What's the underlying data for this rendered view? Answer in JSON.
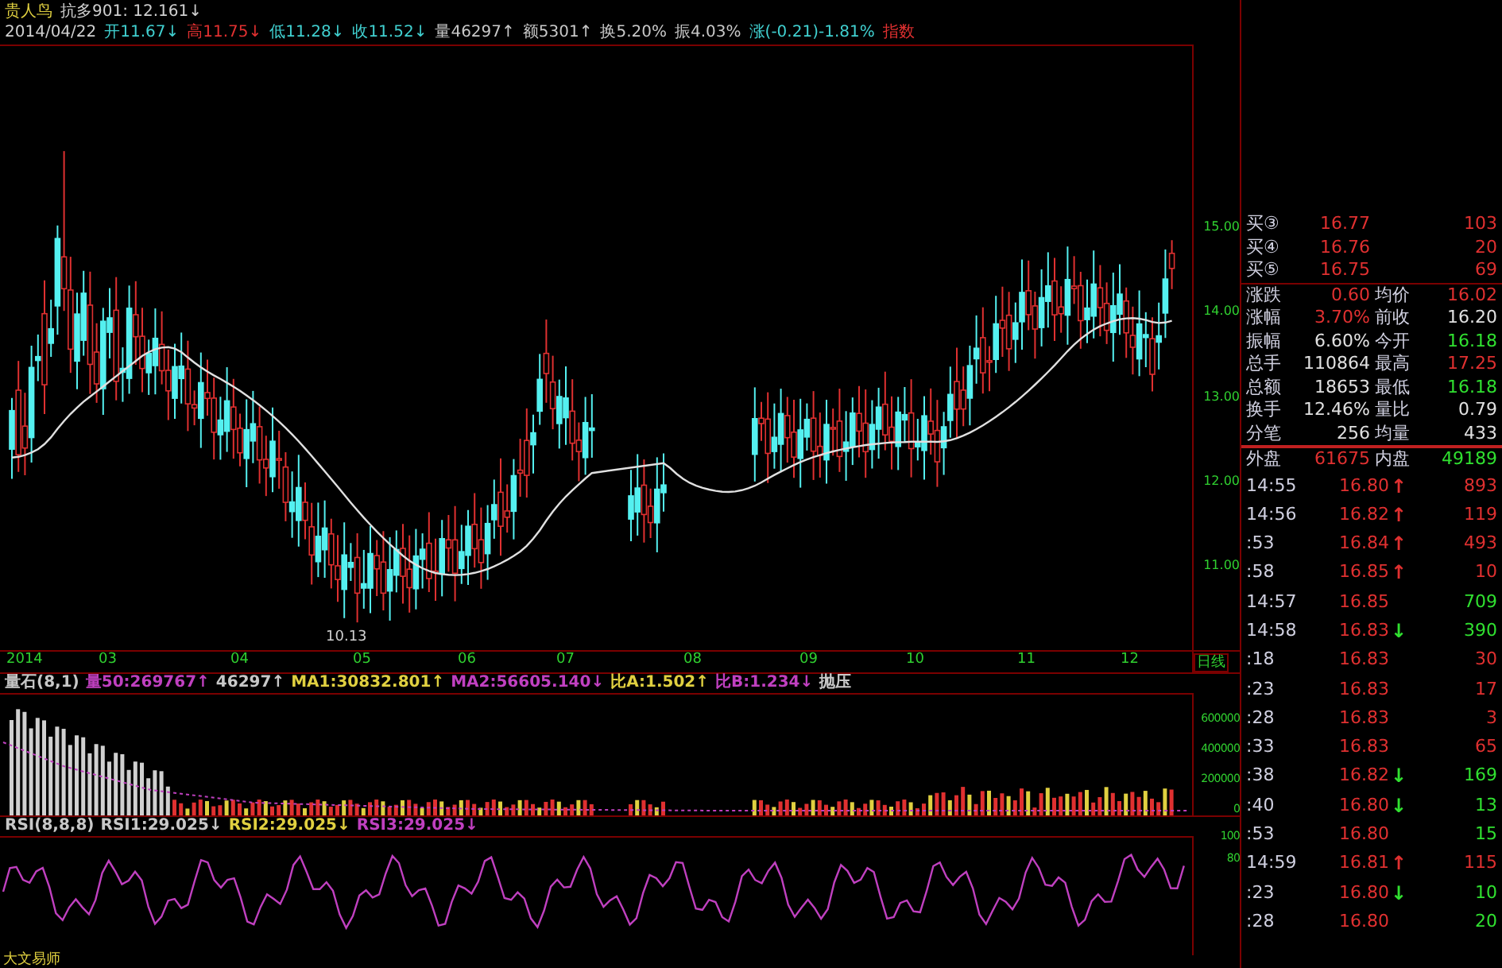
{
  "header": {
    "stock_name": "贵人鸟",
    "indicator": "抗多901: 12.161↓",
    "date": "2014/04/22",
    "fields": [
      {
        "text": "开11.67↓",
        "color": "#40d0d0"
      },
      {
        "text": "高11.75↓",
        "color": "#e03030"
      },
      {
        "text": "低11.28↓",
        "color": "#40d0d0"
      },
      {
        "text": "收11.52↓",
        "color": "#40d0d0"
      },
      {
        "text": "量46297↑",
        "color": "#c8c8c8"
      },
      {
        "text": "额5301↑",
        "color": "#c8c8c8"
      },
      {
        "text": "换5.20%",
        "color": "#c8c8c8"
      },
      {
        "text": "振4.03%",
        "color": "#c8c8c8"
      },
      {
        "text": "涨(-0.21)-1.81%",
        "color": "#40d0d0"
      },
      {
        "text": "指数",
        "color": "#e03030"
      }
    ]
  },
  "price_axis": [
    "15.00",
    "14.00",
    "13.00",
    "12.00",
    "11.00"
  ],
  "low_label": "10.13",
  "x_axis": {
    "labels": [
      "2014",
      "03",
      "04",
      "05",
      "06",
      "07",
      "08",
      "09",
      "10",
      "11",
      "12"
    ],
    "period": "日线"
  },
  "volume_panel": {
    "fields": [
      {
        "text": "量石(8,1)",
        "kind": "name"
      },
      {
        "text": "量50:269767↑",
        "kind": "second"
      },
      {
        "text": "46297↑",
        "kind": "name"
      },
      {
        "text": "MA1:30832.801↑",
        "kind": "first"
      },
      {
        "text": "MA2:56605.140↓",
        "kind": "second"
      },
      {
        "text": "比A:1.502↑",
        "kind": "first"
      },
      {
        "text": "比B:1.234↓",
        "kind": "second"
      },
      {
        "text": "抛压",
        "kind": "name"
      }
    ],
    "axis": [
      "600000",
      "400000",
      "200000",
      "0"
    ]
  },
  "rsi_panel": {
    "fields": [
      {
        "text": "RSI(8,8,8)",
        "kind": "name"
      },
      {
        "text": "RSI1:29.025↓",
        "kind": "name"
      },
      {
        "text": "RSI2:29.025↓",
        "kind": "first"
      },
      {
        "text": "RSI3:29.025↓",
        "kind": "second"
      }
    ],
    "axis": [
      "100",
      "80"
    ]
  },
  "footer": "大文易师",
  "quotes": {
    "bids": [
      {
        "label": "买③",
        "price": "16.77",
        "volume": "103"
      },
      {
        "label": "买④",
        "price": "16.76",
        "volume": "20"
      },
      {
        "label": "买⑤",
        "price": "16.75",
        "volume": "69"
      }
    ],
    "stats": [
      {
        "label": "涨跌",
        "value": "0.60",
        "color": "#e03030"
      },
      {
        "label": "均价",
        "value": "16.02",
        "color": "#e03030"
      },
      {
        "label": "涨幅",
        "value": "3.70%",
        "color": "#e03030"
      },
      {
        "label": "前收",
        "value": "16.20",
        "color": "#e0e0e0"
      },
      {
        "label": "振幅",
        "value": "6.60%",
        "color": "#e0e0e0"
      },
      {
        "label": "今开",
        "value": "16.18",
        "color": "#30e030"
      },
      {
        "label": "总手",
        "value": "110864",
        "color": "#e0e0e0"
      },
      {
        "label": "最高",
        "value": "17.25",
        "color": "#e03030"
      },
      {
        "label": "总额",
        "value": "18653",
        "color": "#e0e0e0"
      },
      {
        "label": "最低",
        "value": "16.18",
        "color": "#30e030"
      },
      {
        "label": "换手",
        "value": "12.46%",
        "color": "#e0e0e0"
      },
      {
        "label": "量比",
        "value": "0.79",
        "color": "#e0e0e0"
      },
      {
        "label": "分笔",
        "value": "256",
        "color": "#e0e0e0"
      },
      {
        "label": "均量",
        "value": "433",
        "color": "#e0e0e0"
      },
      {
        "label": "外盘",
        "value": "61675",
        "color": "#e03030"
      },
      {
        "label": "内盘",
        "value": "49189",
        "color": "#30e030"
      }
    ],
    "ticks": [
      {
        "time": "14:55",
        "price": "16.80",
        "arrow": "↑",
        "volume": "893",
        "color": "#e03030"
      },
      {
        "time": "14:56",
        "price": "16.82",
        "arrow": "↑",
        "volume": "119",
        "color": "#e03030"
      },
      {
        "time": ":53",
        "price": "16.84",
        "arrow": "↑",
        "volume": "493",
        "color": "#e03030"
      },
      {
        "time": ":58",
        "price": "16.85",
        "arrow": "↑",
        "volume": "10",
        "color": "#e03030"
      },
      {
        "time": "14:57",
        "price": "16.85",
        "volume": "709",
        "color": "#30e030"
      },
      {
        "time": "14:58",
        "price": "16.83",
        "arrow": "↓",
        "volume": "390",
        "color": "#30e030"
      },
      {
        "time": ":18",
        "price": "16.83",
        "volume": "30",
        "color": "#e03030"
      },
      {
        "time": ":23",
        "price": "16.83",
        "volume": "17",
        "color": "#e03030"
      },
      {
        "time": ":28",
        "price": "16.83",
        "volume": "3",
        "color": "#e03030"
      },
      {
        "time": ":33",
        "price": "16.83",
        "volume": "65",
        "color": "#e03030"
      },
      {
        "time": ":38",
        "price": "16.82",
        "arrow": "↓",
        "volume": "169",
        "color": "#30e030"
      },
      {
        "time": ":40",
        "price": "16.80",
        "arrow": "↓",
        "volume": "13",
        "color": "#30e030"
      },
      {
        "time": ":53",
        "price": "16.80",
        "volume": "15",
        "color": "#30e030"
      },
      {
        "time": "14:59",
        "price": "16.81",
        "arrow": "↑",
        "volume": "115",
        "color": "#e03030"
      },
      {
        "time": ":23",
        "price": "16.80",
        "arrow": "↓",
        "volume": "10",
        "color": "#30e030"
      },
      {
        "time": ":28",
        "price": "16.80",
        "volume": "20",
        "color": "#30e030"
      }
    ]
  }
}
